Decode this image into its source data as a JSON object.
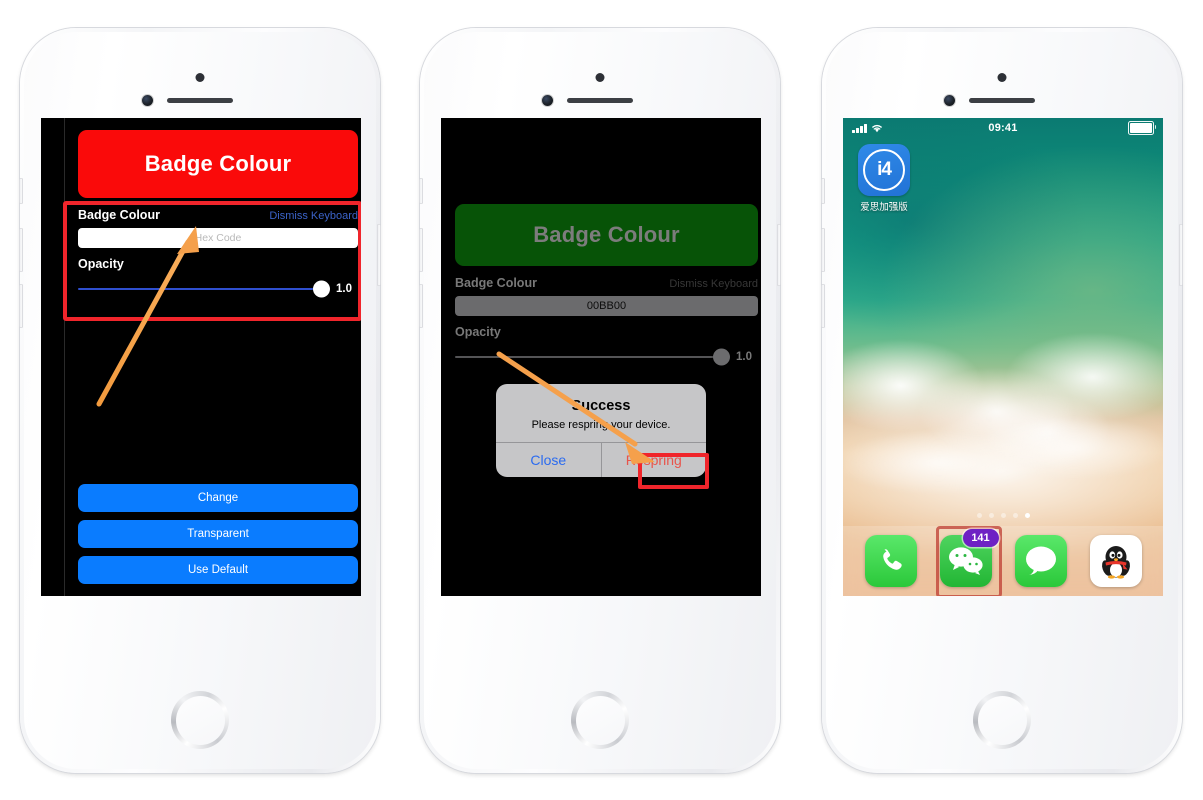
{
  "phones": [
    {
      "id": "phone-1",
      "screen": "badge-colour-app-initial",
      "app": {
        "title_card": {
          "text": "Badge Colour",
          "bg": "#FA0A0A",
          "text_color": "#FFFFFF"
        },
        "section_label": "Badge Colour",
        "dismiss_keyboard": "Dismiss Keyboard",
        "hex_field": {
          "value": "",
          "placeholder": "Hex Code",
          "bg": "#FFFFFF",
          "text_color": "#B9B9B9"
        },
        "opacity_label": "Opacity",
        "opacity_value": "1.0",
        "slider": {
          "track_color": "#2F4FCF",
          "fill_percent": 100
        },
        "buttons": [
          {
            "label": "Change",
            "bg": "#0A7CFF"
          },
          {
            "label": "Transparent",
            "bg": "#0A7CFF"
          },
          {
            "label": "Use Default",
            "bg": "#0A7CFF"
          }
        ],
        "highlight_color": "#F0252B"
      },
      "annotation": {
        "arrow": "orange-arrow-to-hex-field",
        "color": "#F5A04B"
      }
    },
    {
      "id": "phone-2",
      "screen": "badge-colour-app-success-alert",
      "app": {
        "title_card": {
          "text": "Badge Colour",
          "bg": "#0C8A0C",
          "text_color": "#FFFFFF"
        },
        "section_label": "Badge Colour",
        "dismiss_keyboard": "Dismiss Keyboard",
        "hex_field": {
          "value": "00BB00",
          "placeholder": "Hex Code",
          "bg": "#B3B3B6",
          "text_color": "#1A1A1A"
        },
        "opacity_label": "Opacity",
        "opacity_value": "1.0",
        "slider": {
          "track_color": "#8C8C90",
          "fill_percent": 100
        }
      },
      "alert": {
        "title": "Success",
        "message": "Please respring your device.",
        "buttons": [
          {
            "label": "Close",
            "color": "#2B6BF0"
          },
          {
            "label": "Respring",
            "color": "#E8544B",
            "highlighted": true
          }
        ],
        "highlight_color": "#F0252B"
      },
      "annotation": {
        "arrow": "orange-arrow-to-respring-button",
        "color": "#F5A04B"
      }
    },
    {
      "id": "phone-3",
      "screen": "ios-home-screen",
      "statusbar": {
        "time": "09:41",
        "signal_bars": 4,
        "wifi": "wifi-icon",
        "battery_percent": 100
      },
      "apps": [
        {
          "label": "爱思加强版",
          "icon": "i4-app-icon",
          "glyph": "i4"
        }
      ],
      "page_dots": {
        "count": 5,
        "active_index": 4
      },
      "dock": [
        {
          "name": "phone",
          "label": "Phone",
          "badge": null
        },
        {
          "name": "wechat",
          "label": "WeChat",
          "badge": "141",
          "badge_color": "#6E21C4",
          "highlighted": true
        },
        {
          "name": "messages",
          "label": "Messages",
          "badge": null
        },
        {
          "name": "qq",
          "label": "QQ",
          "badge": null
        }
      ]
    }
  ]
}
